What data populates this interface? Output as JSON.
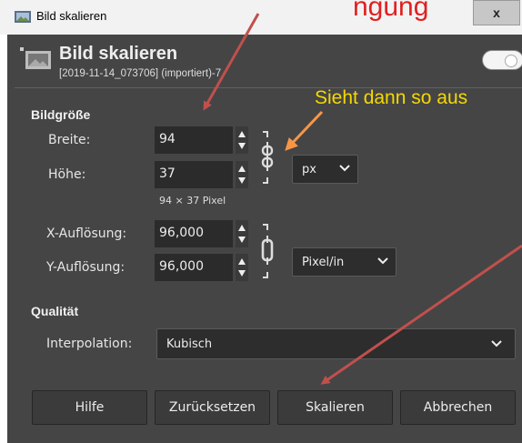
{
  "window": {
    "title": "Bild skalieren",
    "close_label": "x"
  },
  "header": {
    "title": "Bild skalieren",
    "subtitle": "[2019-11-14_073706] (importiert)-7"
  },
  "size_section": {
    "title": "Bildgröße",
    "width_label": "Breite:",
    "width_value": "94",
    "height_label": "Höhe:",
    "height_value": "37",
    "unit": "px",
    "pixel_info": "94 × 37 Pixel",
    "x_res_label": "X-Auflösung:",
    "x_res_value": "96,000",
    "y_res_label": "Y-Auflösung:",
    "y_res_value": "96,000",
    "res_unit": "Pixel/in"
  },
  "quality_section": {
    "title": "Qualität",
    "interpolation_label": "Interpolation:",
    "interpolation_value": "Kubisch"
  },
  "buttons": {
    "help": "Hilfe",
    "reset": "Zurücksetzen",
    "scale": "Skalieren",
    "cancel": "Abbrechen"
  },
  "annotation": {
    "note": "Sieht dann so aus",
    "top_partial": "ngung"
  },
  "colors": {
    "dialog_bg": "#454545",
    "field_bg": "#2b2b2b",
    "note_yellow": "#f5d800",
    "arrow_red": "#c0504d",
    "arrow_orange": "#f79646"
  },
  "icons": [
    "image-icon",
    "close-icon",
    "chain-link-icon",
    "chevron-down-icon",
    "spin-arrows-icon"
  ]
}
